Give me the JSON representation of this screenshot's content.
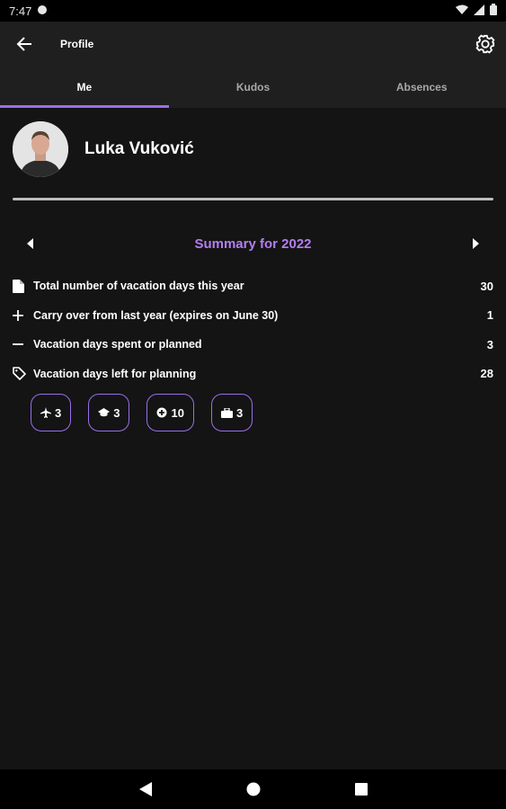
{
  "status_bar": {
    "time": "7:47"
  },
  "app_bar": {
    "title": "Profile"
  },
  "tabs": [
    {
      "label": "Me",
      "active": true
    },
    {
      "label": "Kudos",
      "active": false
    },
    {
      "label": "Absences",
      "active": false
    }
  ],
  "profile": {
    "name": "Luka Vuković"
  },
  "summary": {
    "heading": "Summary for 2022",
    "rows": [
      {
        "icon": "document-icon",
        "label": "Total number of vacation days this year",
        "value": "30"
      },
      {
        "icon": "plus-icon",
        "label": "Carry over from last year (expires on June 30)",
        "value": "1"
      },
      {
        "icon": "minus-icon",
        "label": "Vacation days spent or planned",
        "value": "3"
      },
      {
        "icon": "tag-icon",
        "label": "Vacation days left for planning",
        "value": "28"
      }
    ],
    "chips": [
      {
        "icon": "plane-icon",
        "value": "3"
      },
      {
        "icon": "graduation-cap-icon",
        "value": "3"
      },
      {
        "icon": "medical-icon",
        "value": "10"
      },
      {
        "icon": "briefcase-icon",
        "value": "3"
      }
    ]
  },
  "colors": {
    "accent": "#9b6ee8",
    "heading": "#b47ef0",
    "background": "#141414",
    "bar": "#1f1f1f"
  }
}
